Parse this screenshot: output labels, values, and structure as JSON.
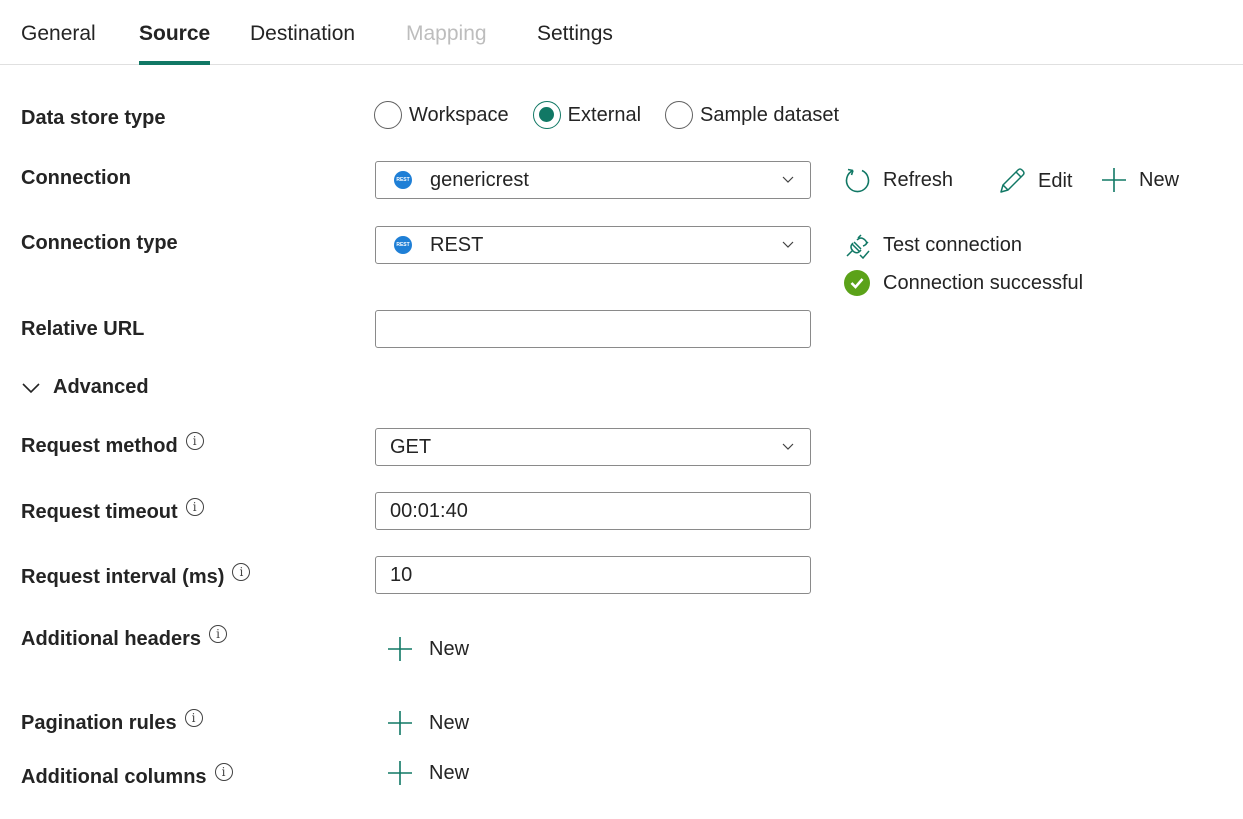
{
  "tabs": [
    {
      "label": "General",
      "state": "normal"
    },
    {
      "label": "Source",
      "state": "active"
    },
    {
      "label": "Destination",
      "state": "normal"
    },
    {
      "label": "Mapping",
      "state": "disabled"
    },
    {
      "label": "Settings",
      "state": "normal"
    }
  ],
  "colors": {
    "accent": "#117865",
    "success": "#5ba219",
    "rest_icon": "#1f7fd6",
    "disabled": "#bdbdbd"
  },
  "form": {
    "data_store_type": {
      "label": "Data store type",
      "options": [
        "Workspace",
        "External",
        "Sample dataset"
      ],
      "selected": "External"
    },
    "connection": {
      "label": "Connection",
      "value": "genericrest",
      "icon": "rest-icon",
      "actions": {
        "refresh": "Refresh",
        "edit": "Edit",
        "new": "New"
      }
    },
    "connection_type": {
      "label": "Connection type",
      "value": "REST",
      "icon": "rest-icon",
      "test_connection": "Test connection",
      "status": "Connection successful"
    },
    "relative_url": {
      "label": "Relative URL",
      "value": ""
    },
    "advanced": {
      "label": "Advanced",
      "expanded": true
    },
    "request_method": {
      "label": "Request method",
      "value": "GET"
    },
    "request_timeout": {
      "label": "Request timeout",
      "value": "00:01:40"
    },
    "request_interval": {
      "label": "Request interval (ms)",
      "value": "10"
    },
    "additional_headers": {
      "label": "Additional headers",
      "new_label": "New"
    },
    "pagination_rules": {
      "label": "Pagination rules",
      "new_label": "New"
    },
    "additional_columns": {
      "label": "Additional columns",
      "new_label": "New"
    }
  },
  "icon_text": {
    "rest": "REST",
    "info": "i"
  }
}
